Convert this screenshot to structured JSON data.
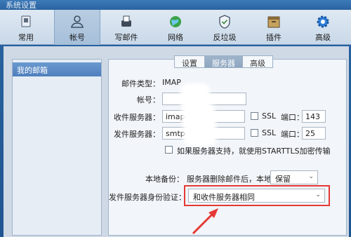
{
  "window": {
    "title": "系统设置"
  },
  "toolbar": {
    "items": [
      {
        "label": "常用",
        "icon": "general-settings-icon"
      },
      {
        "label": "帐号",
        "icon": "account-person-icon"
      },
      {
        "label": "写邮件",
        "icon": "compose-mail-icon"
      },
      {
        "label": "网络",
        "icon": "network-globe-icon"
      },
      {
        "label": "反垃圾",
        "icon": "antispam-shield-icon"
      },
      {
        "label": "插件",
        "icon": "plugin-box-icon"
      },
      {
        "label": "高级",
        "icon": "advanced-gear-icon"
      }
    ],
    "active": "帐号"
  },
  "accounts": {
    "items": [
      "我的邮箱"
    ]
  },
  "tabs": {
    "items": [
      "设置",
      "服务器",
      "高级"
    ],
    "active": "服务器"
  },
  "form": {
    "mail_type_label": "邮件类型：",
    "mail_type_value": "IMAP",
    "account_label": "帐号：",
    "incoming_label": "收件服务器：",
    "incoming_value": "imap",
    "incoming_ssl": "SSL",
    "incoming_port_label": "端口：",
    "incoming_port": "143",
    "outgoing_label": "发件服务器：",
    "outgoing_value": "smtp.",
    "outgoing_ssl": "SSL",
    "outgoing_port_label": "端口：",
    "outgoing_port": "25",
    "starttls_label": "如果服务器支持，就使用STARTTLS加密传输",
    "backup_label": "本地备份：",
    "backup_desc": "服务器删除邮件后，本地",
    "backup_value": "保留",
    "auth_label": "发件服务器身份验证：",
    "auth_value": "和收件服务器相同"
  },
  "colors": {
    "highlight": "#e53935",
    "accent": "#1f5590"
  }
}
